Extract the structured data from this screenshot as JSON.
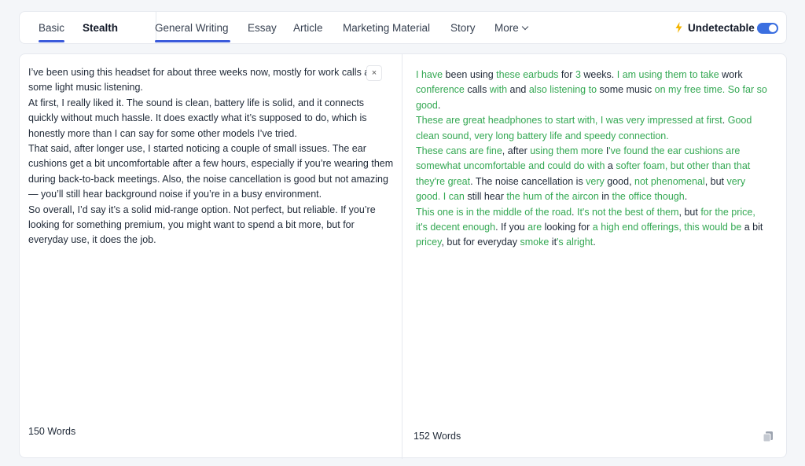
{
  "tabs": {
    "basic": "Basic",
    "stealth": "Stealth",
    "general_writing": "General Writing",
    "essay": "Essay",
    "article": "Article",
    "marketing": "Marketing Material",
    "story": "Story",
    "more": "More"
  },
  "mode": {
    "label": "Undetectable",
    "enabled": true
  },
  "colors": {
    "accent": "#3b5bdb",
    "changed_text": "#34a853",
    "unchanged_text": "#1f2937",
    "bolt": "#f4b400"
  },
  "icons": {
    "bolt": "bolt-icon",
    "close": "close-icon",
    "copy": "copy-icon",
    "chevron": "chevron-down-icon"
  },
  "input": {
    "paragraphs": [
      "I’ve been using this headset for about three weeks now, mostly for work calls and some light music listening.",
      "At first, I really liked it. The sound is clean, battery life is solid, and it connects quickly without much hassle. It does exactly what it’s supposed to do, which is honestly more than I can say for some other models I’ve tried.",
      "That said, after longer use, I started noticing a couple of small issues. The ear cushions get a bit uncomfortable after a few hours, especially if you’re wearing them during back-to-back meetings. Also, the noise cancellation is good but not amazing — you’ll still hear background noise if you’re in a busy environment.",
      "So overall, I’d say it’s a solid mid-range option. Not perfect, but reliable. If you’re looking for something premium, you might want to spend a bit more, but for everyday use, it does the job."
    ],
    "word_count": "150 Words",
    "clear_label": "×"
  },
  "output": {
    "paragraphs": [
      [
        [
          "g",
          "I have"
        ],
        [
          "k",
          " been using "
        ],
        [
          "g",
          "these earbuds"
        ],
        [
          "k",
          " for "
        ],
        [
          "g",
          "3"
        ],
        [
          "k",
          " weeks. "
        ],
        [
          "g",
          "I am using them to take"
        ],
        [
          "k",
          " work "
        ],
        [
          "g",
          "conference"
        ],
        [
          "k",
          " calls "
        ],
        [
          "g",
          "with"
        ],
        [
          "k",
          " and "
        ],
        [
          "g",
          "also listening to"
        ],
        [
          "k",
          " some music "
        ],
        [
          "g",
          "on my free time. So far so good"
        ],
        [
          "k",
          "."
        ]
      ],
      [
        [
          "g",
          "These are great headphones to start with, I was very impressed at first"
        ],
        [
          "k",
          ". "
        ],
        [
          "g",
          "Good clean sound, very long battery life and speedy connection."
        ]
      ],
      [
        [
          "g",
          "These cans are fine"
        ],
        [
          "k",
          ", after "
        ],
        [
          "g",
          "using them more"
        ],
        [
          "k",
          " I"
        ],
        [
          "g",
          "'ve found the ear cushions are somewhat uncomfortable and could do with"
        ],
        [
          "k",
          " a "
        ],
        [
          "g",
          "softer foam, but other than that they're great"
        ],
        [
          "k",
          ". The noise cancellation is "
        ],
        [
          "g",
          "very"
        ],
        [
          "k",
          " good, "
        ],
        [
          "g",
          "not phenomenal"
        ],
        [
          "k",
          ", but "
        ],
        [
          "g",
          "very good. I can"
        ],
        [
          "k",
          " still hear "
        ],
        [
          "g",
          "the hum of the aircon"
        ],
        [
          "k",
          " in "
        ],
        [
          "g",
          "the office though"
        ],
        [
          "k",
          "."
        ]
      ],
      [
        [
          "g",
          "This one is in the middle of the road"
        ],
        [
          "k",
          ". "
        ],
        [
          "g",
          "It's not the best of them"
        ],
        [
          "k",
          ", but "
        ],
        [
          "g",
          "for the price, it's decent enough"
        ],
        [
          "k",
          ". If you "
        ],
        [
          "g",
          "are"
        ],
        [
          "k",
          " looking for "
        ],
        [
          "g",
          "a high end offerings, this would be"
        ],
        [
          "k",
          " a bit "
        ],
        [
          "g",
          "pricey"
        ],
        [
          "k",
          ", but for everyday "
        ],
        [
          "g",
          "smoke"
        ],
        [
          "k",
          " it"
        ],
        [
          "g",
          "'s alright"
        ],
        [
          "k",
          "."
        ]
      ]
    ],
    "word_count": "152 Words"
  }
}
